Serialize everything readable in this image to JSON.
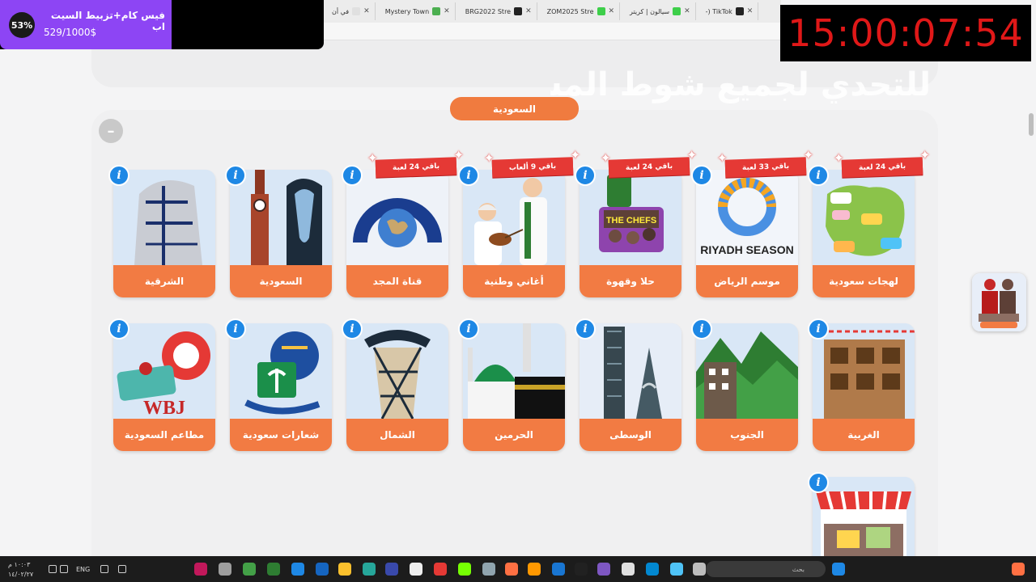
{
  "overlay": {
    "goal": {
      "percent_label": "53%",
      "percent": 0.53,
      "title": "فيس كام+تزبيط السيت اب",
      "count": "529/1000$"
    },
    "timer": "15:00:07:54",
    "banner_text": "للتحدي لجميع شوط المشاهدات"
  },
  "browser": {
    "tabs": [
      {
        "label": "في أن",
        "color": "#e0e0e0"
      },
      {
        "label": "Mystery Town",
        "color": "#4caf50"
      },
      {
        "label": "BRG2022 Stre",
        "color": "#222222"
      },
      {
        "label": "ZOM2025 Stre",
        "color": "#3ecf4a"
      },
      {
        "label": "سيالون | كريتر",
        "color": "#3ecf4a"
      },
      {
        "label": "-) TikTok",
        "color": "#222222"
      }
    ]
  },
  "page": {
    "section_title": "السعودية",
    "collapse_symbol": "–",
    "info_symbol": "i",
    "cards": [
      {
        "label": "لهجات سعودية",
        "badge": "باقي 24 لعبة",
        "art": "dialects"
      },
      {
        "label": "موسم الرياض",
        "badge": "باقي 33 لعبة",
        "art": "riyadh",
        "art_text": "RIYADH SEASON"
      },
      {
        "label": "حلا وقهوة",
        "badge": "باقي 24 لعبة",
        "art": "coffee",
        "art_text": "THE CHEFS"
      },
      {
        "label": "أغاني وطنية",
        "badge": "باقي 9 ألعاب",
        "art": "songs"
      },
      {
        "label": "قناة المجد",
        "badge": "باقي 24 لعبة",
        "art": "majd"
      },
      {
        "label": "السعودية",
        "badge": "",
        "art": "saudi"
      },
      {
        "label": "الشرقية",
        "badge": "",
        "art": "eastern"
      },
      {
        "label": "الغربية",
        "badge": "",
        "art": "western"
      },
      {
        "label": "الجنوب",
        "badge": "",
        "art": "south"
      },
      {
        "label": "الوسطى",
        "badge": "",
        "art": "central"
      },
      {
        "label": "الحرمين",
        "badge": "",
        "art": "haramain"
      },
      {
        "label": "الشمال",
        "badge": "",
        "art": "north"
      },
      {
        "label": "شعارات سعودية",
        "badge": "",
        "art": "logos"
      },
      {
        "label": "مطاعم السعودية",
        "badge": "",
        "art": "restaurants",
        "art_text": "WBJ"
      },
      {
        "label": "",
        "badge": "",
        "art": "market"
      }
    ]
  },
  "taskbar": {
    "search_placeholder": "بحث",
    "language": "ENG",
    "clock_time": "١٠:٠٣ م",
    "clock_date": "١٤/٠٢/٢٧"
  }
}
